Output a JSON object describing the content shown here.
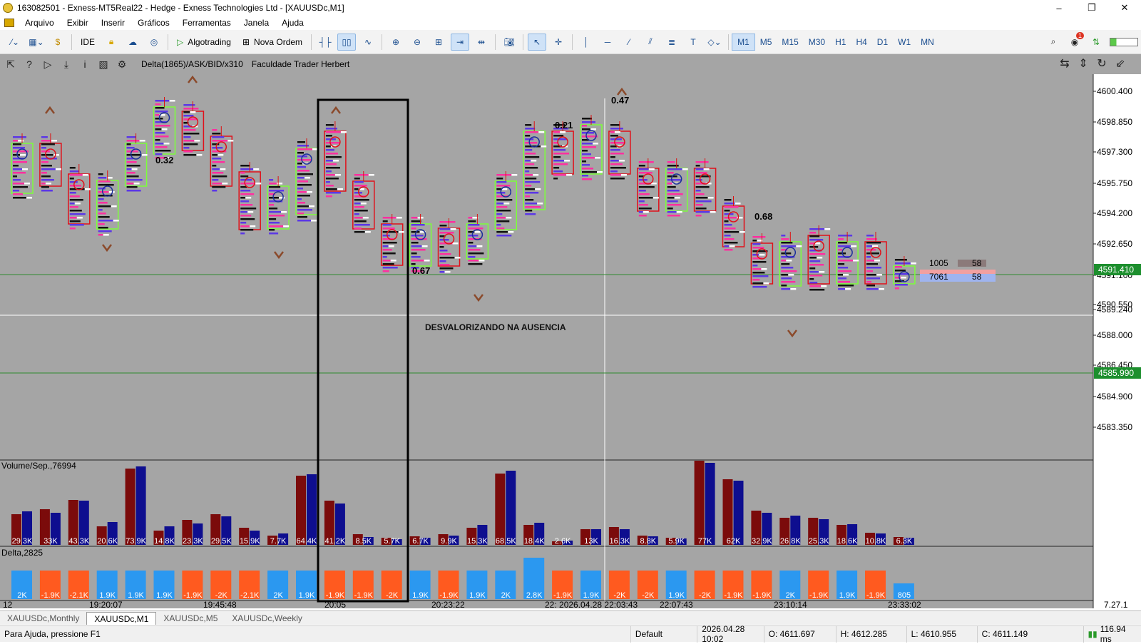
{
  "window": {
    "title": "163082501 - Exness-MT5Real22 - Hedge - Exness Technologies Ltd - [XAUUSDc,M1]",
    "min": "–",
    "max": "❐",
    "close": "✕"
  },
  "menu": [
    "Arquivo",
    "Exibir",
    "Inserir",
    "Gráficos",
    "Ferramentas",
    "Janela",
    "Ajuda"
  ],
  "toolbar": {
    "ide": "IDE",
    "algotrading": "Algotrading",
    "nova_ordem": "Nova Ordem",
    "timeframes": [
      "M1",
      "M5",
      "M15",
      "M30",
      "H1",
      "H4",
      "D1",
      "W1",
      "MN"
    ],
    "selected_tf": "M1",
    "notif_count": "1"
  },
  "chart": {
    "indicator_name": "Delta(1865)/ASK/BID/x310",
    "indicator_owner": "Faculdade Trader Herbert",
    "annotation": "DESVALORIZANDO NA AUSENCIA",
    "price_labels": [
      "4600.400",
      "4598.850",
      "4597.300",
      "4595.750",
      "4594.200",
      "4592.650",
      "4591.100",
      "4590.550",
      "4589.240",
      "4588.000",
      "4586.450",
      "4584.900",
      "4583.350"
    ],
    "current_price": "4591.410",
    "line_price": "4585.990",
    "markers": [
      "0.32",
      "0.47",
      "0.21",
      "0.68",
      "0.67"
    ],
    "panel_volume": "Volume/Sep.,76994",
    "panel_delta": "Delta,2825",
    "volume_labels": [
      "29.3K",
      "33K",
      "43.3K",
      "20.6K",
      "73.9K",
      "14.8K",
      "23.3K",
      "29.5K",
      "15.9K",
      "7.7K",
      "64.4K",
      "41.2K",
      "8.5K",
      "5.7K",
      "6.7K",
      "9.9K",
      "15.3K",
      "68.5K",
      "18.4K",
      "2.6K",
      "13K",
      "16.3K",
      "8.8K",
      "5.9K",
      "77K",
      "62K",
      "32.9K",
      "26.8K",
      "25.3K",
      "18.6K",
      "10.8K",
      "6.3K"
    ],
    "delta_labels": [
      "2K",
      "-1.9K",
      "-2.1K",
      "1.9K",
      "1.9K",
      "1.9K",
      "-1.9K",
      "-2K",
      "-2.1K",
      "2K",
      "1.9K",
      "-1.9K",
      "-1.9K",
      "-2K",
      "1.9K",
      "-1.9K",
      "1.9K",
      "2K",
      "2.8K",
      "-1.9K",
      "1.9K",
      "-2K",
      "-2K",
      "1.9K",
      "-2K",
      "-1.9K",
      "-1.9K",
      "2K",
      "-1.9K",
      "1.9K",
      "-1.9K",
      "805"
    ],
    "time_labels": [
      "12",
      "19:20:07",
      "19:45:48",
      "20:05",
      "20:23:22",
      "22: 2026.04.28 22:03:43",
      "22:07:43",
      "23:10:14",
      "23:33:02",
      "7.27.1"
    ],
    "side_box": {
      "a1": "1005",
      "a2": "58",
      "b1": "7061",
      "b2": "58"
    }
  },
  "tabs": [
    "XAUUSDc,Monthly",
    "XAUUSDc,M1",
    "XAUUSDc,M5",
    "XAUUSDc,Weekly"
  ],
  "active_tab": "XAUUSDc,M1",
  "status": {
    "help": "Para Ajuda, pressione F1",
    "profile": "Default",
    "datetime": "2026.04.28 10:02",
    "open": "O: 4611.697",
    "high": "H: 4612.285",
    "low": "L: 4610.955",
    "close": "C: 4611.149",
    "ping": "116.94 ms"
  }
}
